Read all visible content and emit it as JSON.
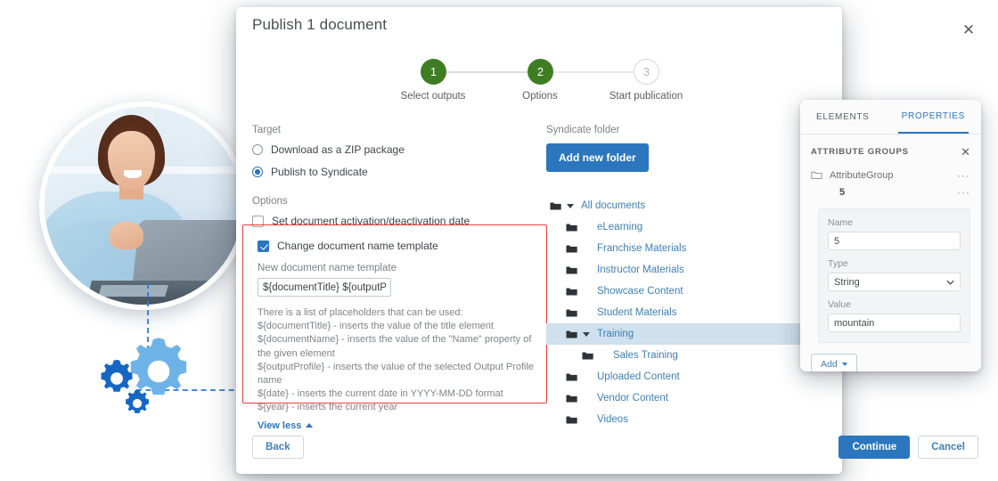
{
  "dialog": {
    "title": "Publish 1 document",
    "close_icon": "close-icon",
    "steps": [
      {
        "num": "1",
        "label": "Select outputs",
        "state": "done"
      },
      {
        "num": "2",
        "label": "Options",
        "state": "done"
      },
      {
        "num": "3",
        "label": "Start publication",
        "state": "idle"
      }
    ],
    "left": {
      "target_label": "Target",
      "radios": [
        {
          "label": "Download as a ZIP package",
          "checked": false
        },
        {
          "label": "Publish to Syndicate",
          "checked": true
        }
      ],
      "options_label": "Options",
      "checkboxes": [
        {
          "label": "Set document activation/deactivation date",
          "checked": false
        },
        {
          "label": "Change document name template",
          "checked": true
        }
      ],
      "template_field_label": "New document name template",
      "template_value": "${documentTitle} ${outputPr",
      "help_intro": "There is a list of placeholders that can be used:",
      "help_lines": [
        "${documentTitle} - inserts the value of the title element",
        "${documentName} - inserts the value of the \"Name\" property of the given element",
        "${outputProfile} - inserts the value of the selected Output Profile name",
        "${date} - inserts the current date in YYYY-MM-DD format",
        "${year} - inserts the current year"
      ],
      "view_less": "View less",
      "highlight_color": "#ef3b36"
    },
    "right": {
      "syndicate_label": "Syndicate folder",
      "add_folder_button": "Add new folder",
      "tree": [
        {
          "label": "All documents",
          "depth": 0,
          "expandable": true,
          "selected": false
        },
        {
          "label": "eLearning",
          "depth": 1,
          "expandable": false,
          "selected": false
        },
        {
          "label": "Franchise Materials",
          "depth": 1,
          "expandable": false,
          "selected": false
        },
        {
          "label": "Instructor Materials",
          "depth": 1,
          "expandable": false,
          "selected": false
        },
        {
          "label": "Showcase Content",
          "depth": 1,
          "expandable": false,
          "selected": false
        },
        {
          "label": "Student Materials",
          "depth": 1,
          "expandable": false,
          "selected": false
        },
        {
          "label": "Training",
          "depth": 1,
          "expandable": true,
          "selected": true
        },
        {
          "label": "Sales Training",
          "depth": 2,
          "expandable": false,
          "selected": false
        },
        {
          "label": "Uploaded Content",
          "depth": 1,
          "expandable": false,
          "selected": false
        },
        {
          "label": "Vendor Content",
          "depth": 1,
          "expandable": false,
          "selected": false
        },
        {
          "label": "Videos",
          "depth": 1,
          "expandable": false,
          "selected": false
        }
      ]
    },
    "footer": {
      "back": "Back",
      "continue": "Continue",
      "cancel": "Cancel"
    }
  },
  "properties_panel": {
    "tabs": [
      {
        "label": "ELEMENTS",
        "active": false
      },
      {
        "label": "PROPERTIES",
        "active": true
      }
    ],
    "header": "ATTRIBUTE GROUPS",
    "close_icon": "close-icon",
    "group_name": "AttributeGroup",
    "group_value": "5",
    "dots": "···",
    "fields": {
      "name_label": "Name",
      "name_value": "5",
      "type_label": "Type",
      "type_value": "String",
      "value_label": "Value",
      "value_value": "mountain"
    },
    "add_button": "Add"
  },
  "decoration": {
    "photo_alt": "woman-smiling-at-laptop",
    "gears": [
      {
        "name": "gear-large",
        "color": "#6db3e8"
      },
      {
        "name": "gear-medium",
        "color": "#1667c4"
      },
      {
        "name": "gear-small",
        "color": "#1667c4"
      }
    ],
    "connector_color": "#2f7ed8"
  }
}
